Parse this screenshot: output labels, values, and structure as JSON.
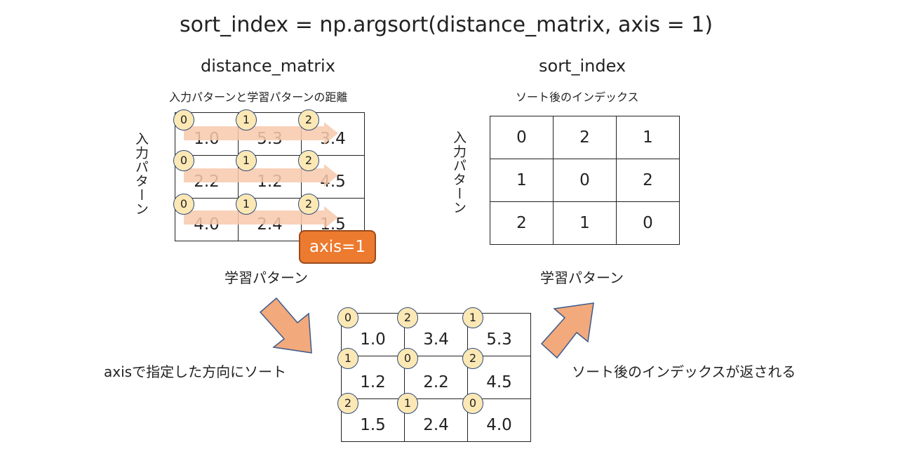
{
  "code_title": "sort_index = np.argsort(distance_matrix, axis = 1)",
  "distance_matrix": {
    "heading": "distance_matrix",
    "caption": "入力パターンと学習パターンの距離",
    "row_label": "入力パターン",
    "col_label": "学習パターン",
    "axis_badge": "axis=1",
    "col_indices": [
      "0",
      "1",
      "2"
    ],
    "rows": [
      [
        "1.0",
        "5.3",
        "3.4"
      ],
      [
        "2.2",
        "1.2",
        "4.5"
      ],
      [
        "4.0",
        "2.4",
        "1.5"
      ]
    ]
  },
  "sorted_matrix": {
    "rows": [
      {
        "idx": [
          "0",
          "2",
          "1"
        ],
        "vals": [
          "1.0",
          "3.4",
          "5.3"
        ]
      },
      {
        "idx": [
          "1",
          "0",
          "2"
        ],
        "vals": [
          "1.2",
          "2.2",
          "4.5"
        ]
      },
      {
        "idx": [
          "2",
          "1",
          "0"
        ],
        "vals": [
          "1.5",
          "2.4",
          "4.0"
        ]
      }
    ]
  },
  "sort_index": {
    "heading": "sort_index",
    "caption": "ソート後のインデックス",
    "row_label": "入力パターン",
    "col_label": "学習パターン",
    "rows": [
      [
        "0",
        "2",
        "1"
      ],
      [
        "1",
        "0",
        "2"
      ],
      [
        "2",
        "1",
        "0"
      ]
    ]
  },
  "left_step_label": "axisで指定した方向にソート",
  "right_step_label": "ソート後のインデックスが返される",
  "colors": {
    "badge_fill": "#fbe8b5",
    "badge_border": "#2f4a76",
    "axis_box": "#ec7a2f",
    "row_arrow": "#f7c9ac",
    "step_arrow": "#f2a97c"
  }
}
